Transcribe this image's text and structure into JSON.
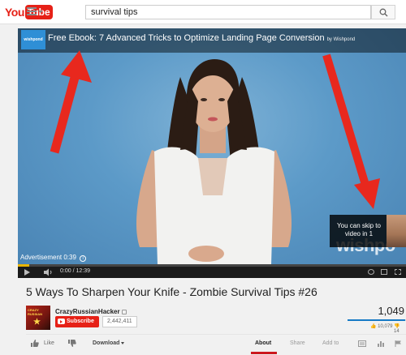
{
  "masthead": {
    "logo_you": "You",
    "logo_tube": "Tube",
    "search_value": "survival tips"
  },
  "player": {
    "ad_brand": "wishpond",
    "ad_title": "Free Ebook: 7 Advanced Tricks to Optimize Landing Page Conversion",
    "ad_by": "by Wishpond",
    "watermark": "wishpo",
    "ad_label": "Advertisement 0:39",
    "skip_text": "You can skip to video in 1",
    "time": "0:00 / 12:39",
    "progress": 0.03
  },
  "video": {
    "title": "5 Ways To Sharpen Your Knife - Zombie Survival Tips #26",
    "channel_name": "CrazyRussianHacker",
    "avatar_text": "CRAZY RUSSIAN",
    "subscribe_label": "Subscribe",
    "subscriber_count": "2,442,411",
    "view_count": "1,049",
    "like_count": "10,079",
    "dislike_count": "14",
    "like_ratio": 0.98
  },
  "actions": {
    "like_label": "Like",
    "download_label": "Download"
  },
  "tabs": [
    {
      "label": "About",
      "active": true
    },
    {
      "label": "Share",
      "active": false
    },
    {
      "label": "Add to",
      "active": false
    }
  ],
  "colors": {
    "brand_red": "#e62117",
    "arrow_red": "#e8281e",
    "progress_yellow": "#e8b400",
    "link_blue": "#167ac6"
  }
}
